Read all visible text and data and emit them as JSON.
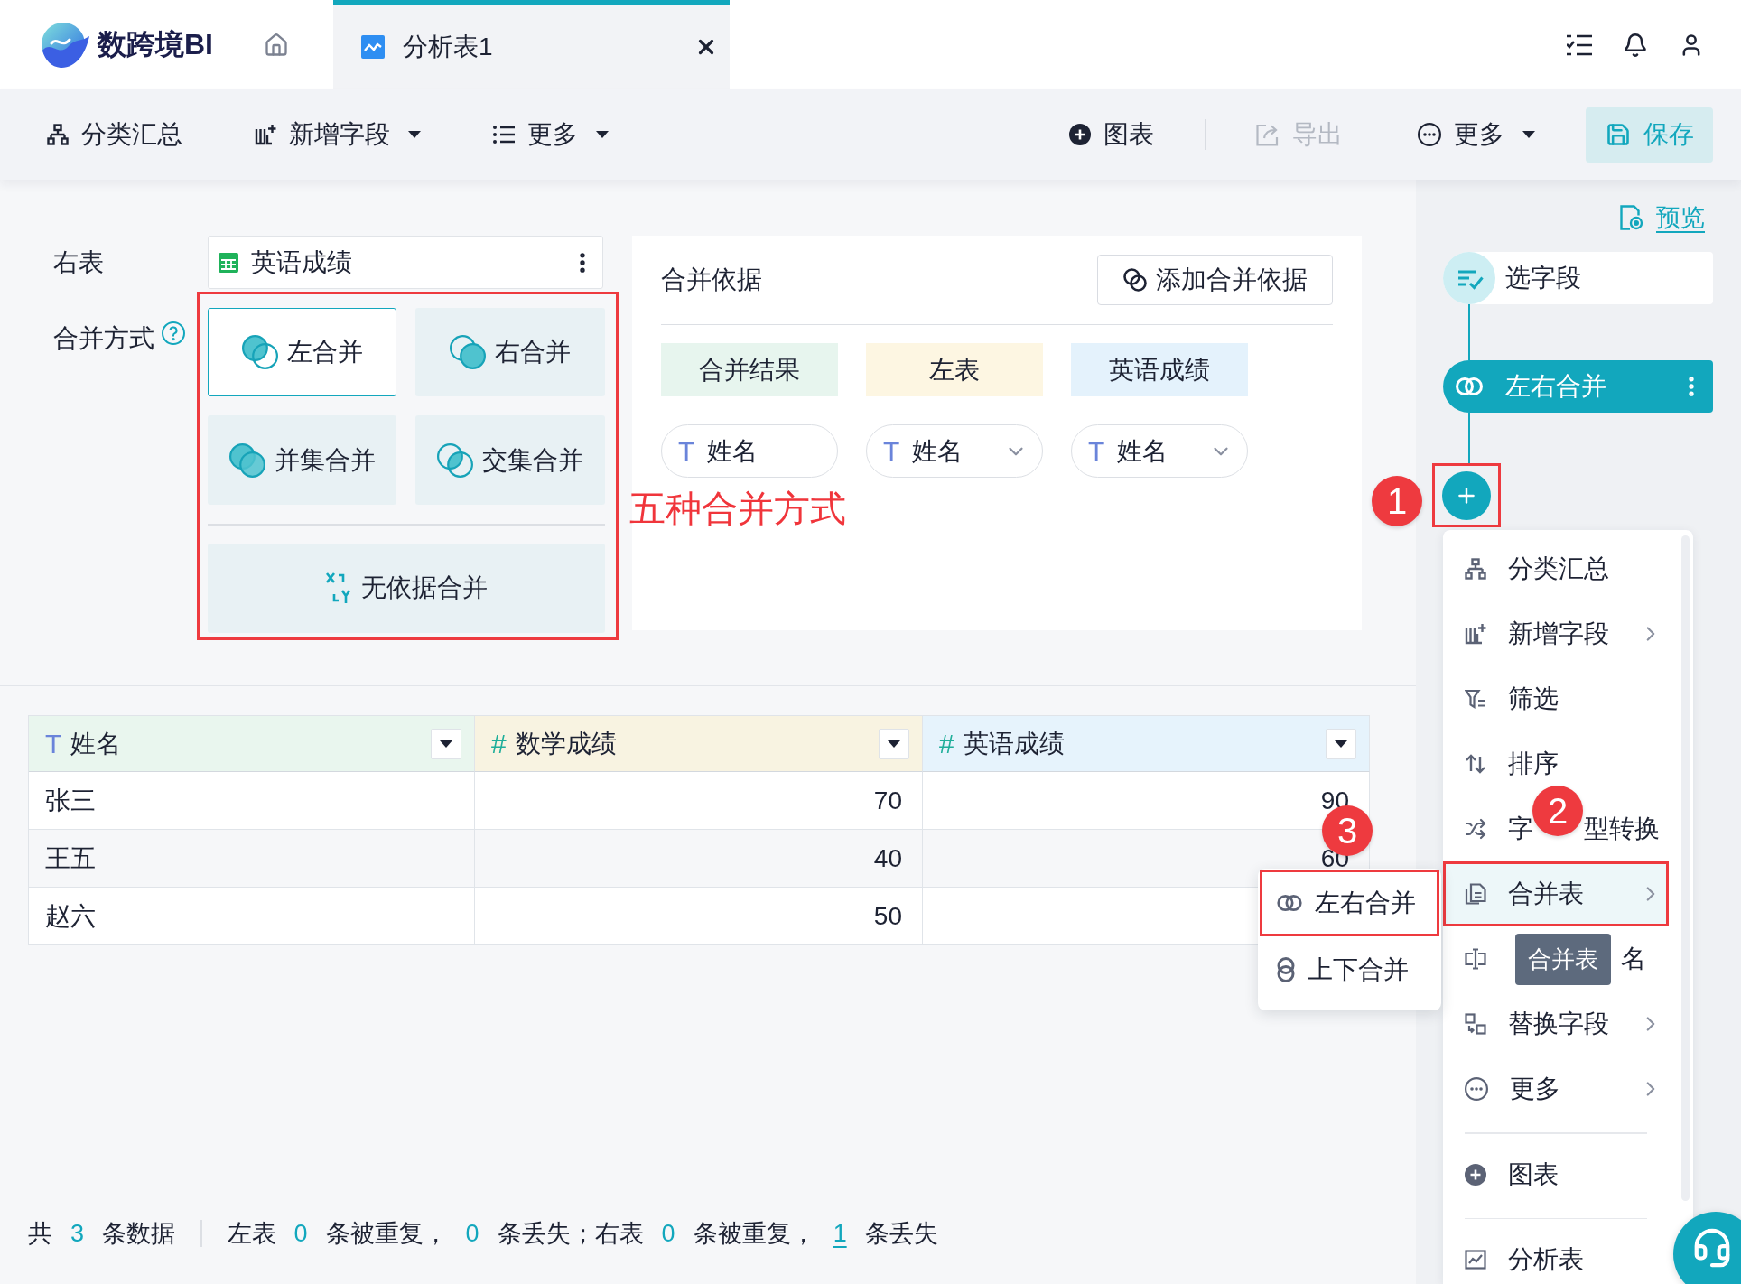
{
  "app": {
    "name": "数跨境BI"
  },
  "tabs": [
    {
      "label": "分析表1",
      "selected": true
    }
  ],
  "toolbar": {
    "left": [
      {
        "label": "分类汇总",
        "dropdown": false
      },
      {
        "label": "新增字段",
        "dropdown": true
      },
      {
        "label": "更多",
        "dropdown": true
      }
    ],
    "right": [
      {
        "label": "图表",
        "dropdown": false,
        "disabled": false
      },
      {
        "label": "导出",
        "dropdown": false,
        "disabled": true
      },
      {
        "label": "更多",
        "dropdown": true,
        "disabled": false
      }
    ],
    "save": "保存"
  },
  "config": {
    "right_table": {
      "label": "右表",
      "value": "英语成绩"
    },
    "merge_mode": {
      "label": "合并方式",
      "outlined": true,
      "caption": "五种合并方式",
      "options": [
        {
          "kind": "left",
          "label": "左合并",
          "selected": true
        },
        {
          "kind": "right",
          "label": "右合并",
          "selected": false
        },
        {
          "kind": "union",
          "label": "并集合并",
          "selected": false
        },
        {
          "kind": "intersect",
          "label": "交集合并",
          "selected": false
        },
        {
          "kind": "none",
          "label": "无依据合并",
          "selected": false
        }
      ]
    }
  },
  "merge_basis": {
    "title": "合并依据",
    "add_button": "添加合并依据",
    "columns": [
      {
        "label": "合并结果",
        "color": "#e7f5ee"
      },
      {
        "label": "左表",
        "color": "#fdf6e2"
      },
      {
        "label": "英语成绩",
        "color": "#e4f2fc"
      }
    ],
    "fields": [
      {
        "kind": "text",
        "type_mark": "T",
        "name": "姓名",
        "dropdown": false
      },
      {
        "kind": "text",
        "type_mark": "T",
        "name": "姓名",
        "dropdown": true
      },
      {
        "kind": "text",
        "type_mark": "T",
        "name": "姓名",
        "dropdown": true
      }
    ]
  },
  "table": {
    "columns": [
      {
        "kind": "text",
        "type_mark": "T",
        "label": "姓名",
        "color": "#e9f6ee"
      },
      {
        "kind": "number",
        "type_mark": "#",
        "label": "数学成绩",
        "color": "#f8f3e1"
      },
      {
        "kind": "number",
        "type_mark": "#",
        "label": "英语成绩",
        "color": "#e6f3fc"
      }
    ],
    "rows": [
      [
        "张三",
        "70",
        "90"
      ],
      [
        "王五",
        "40",
        "60"
      ],
      [
        "赵六",
        "50"
      ]
    ]
  },
  "status_bar": {
    "segments": [
      {
        "kind": "text",
        "text": "共"
      },
      {
        "kind": "count",
        "text": "3"
      },
      {
        "kind": "text",
        "text": "条数据"
      },
      {
        "kind": "divider"
      },
      {
        "kind": "text",
        "text": "左表"
      },
      {
        "kind": "count",
        "text": "0"
      },
      {
        "kind": "text",
        "text": "条被重复，"
      },
      {
        "kind": "count",
        "text": "0"
      },
      {
        "kind": "text",
        "text": "条丢失；右表"
      },
      {
        "kind": "count",
        "text": "0"
      },
      {
        "kind": "text",
        "text": "条被重复，"
      },
      {
        "kind": "link",
        "text": "1"
      },
      {
        "kind": "text",
        "text": "条丢失"
      }
    ]
  },
  "preview": "预览",
  "flow": {
    "nodes": [
      {
        "label": "选字段",
        "selected": false
      },
      {
        "label": "左右合并",
        "selected": true
      }
    ],
    "add_button": {
      "outlined": true
    }
  },
  "menu": {
    "tooltip": "合并表",
    "items": [
      {
        "kind": "item",
        "label": "分类汇总",
        "submenu": false,
        "selected": false,
        "outlined": false
      },
      {
        "kind": "item",
        "label": "新增字段",
        "submenu": true,
        "selected": false,
        "outlined": false
      },
      {
        "kind": "item",
        "label": "筛选",
        "submenu": false,
        "selected": false,
        "outlined": false
      },
      {
        "kind": "item",
        "label": "排序",
        "submenu": false,
        "selected": false,
        "outlined": false
      },
      {
        "kind": "split",
        "label_start": "字",
        "label_end": "型转换",
        "submenu": false,
        "selected": false,
        "outlined": false
      },
      {
        "kind": "item",
        "label": "合并表",
        "submenu": true,
        "selected": true,
        "outlined": true
      },
      {
        "kind": "tooltip",
        "label_end": "名",
        "selected": false,
        "outlined": false
      },
      {
        "kind": "item",
        "label": "替换字段",
        "submenu": true,
        "selected": false,
        "outlined": false
      },
      {
        "kind": "item",
        "label": "更多",
        "submenu": true,
        "selected": false,
        "outlined": false
      },
      {
        "kind": "divider"
      },
      {
        "kind": "item",
        "label": "图表",
        "submenu": false,
        "selected": false,
        "outlined": false
      },
      {
        "kind": "divider"
      },
      {
        "kind": "item",
        "label": "分析表",
        "submenu": false,
        "selected": false,
        "outlined": false
      }
    ]
  },
  "submenu": {
    "items": [
      {
        "label": "左右合并",
        "outlined": true
      },
      {
        "label": "上下合并",
        "outlined": false
      }
    ]
  },
  "callouts": [
    "1",
    "2",
    "3"
  ]
}
